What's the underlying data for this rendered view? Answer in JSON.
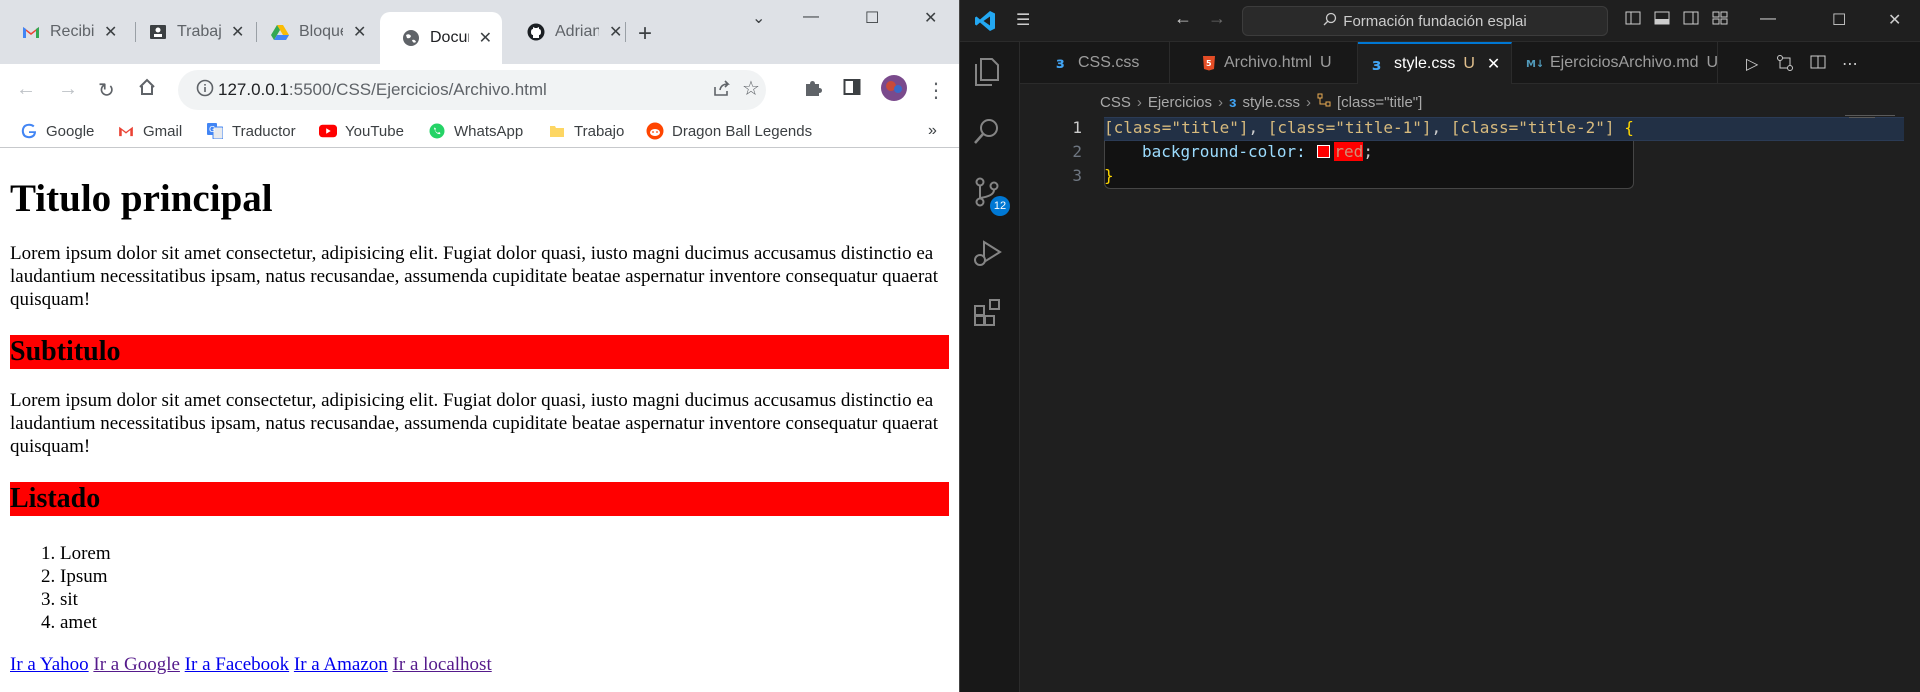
{
  "chrome": {
    "tabs": [
      {
        "title": "Recibi",
        "icon": "gmail-icon"
      },
      {
        "title": "Trabaj",
        "icon": "classroom-icon"
      },
      {
        "title": "Bloque",
        "icon": "drive-icon"
      },
      {
        "title": "Docum",
        "icon": "globe-icon",
        "active": true
      },
      {
        "title": "Adrian",
        "icon": "github-icon"
      }
    ],
    "new_tab": "+",
    "url_host": "127.0.0.1",
    "url_path": ":5500/CSS/Ejercicios/Archivo.html",
    "bookmarks": [
      "Google",
      "Gmail",
      "Traductor",
      "YouTube",
      "WhatsApp",
      "Trabajo",
      "Dragon Ball Legends"
    ],
    "bookmarks_more": "»"
  },
  "page": {
    "title": "Titulo principal",
    "paragraph1": "Lorem ipsum dolor sit amet consectetur, adipisicing elit. Fugiat dolor quasi, iusto magni ducimus accusamus distinctio ea laudantium necessitatibus ipsam, natus recusandae, assumenda cupiditate beatae aspernatur inventore consequatur quaerat quisquam!",
    "subtitle": "Subtitulo",
    "paragraph2": "Lorem ipsum dolor sit amet consectetur, adipisicing elit. Fugiat dolor quasi, iusto magni ducimus accusamus distinctio ea laudantium necessitatibus ipsam, natus recusandae, assumenda cupiditate beatae aspernatur inventore consequatur quaerat quisquam!",
    "list_heading": "Listado",
    "list": [
      "Lorem",
      "Ipsum",
      "sit",
      "amet"
    ],
    "links": [
      "Ir a Yahoo",
      "Ir a Google",
      "Ir a Facebook",
      "Ir a Amazon",
      "Ir a localhost"
    ]
  },
  "vscode": {
    "search": "Formación fundación esplai",
    "scm_badge": "12",
    "tabs": [
      {
        "title": "CSS.css",
        "modified": ""
      },
      {
        "title": "Archivo.html",
        "modified": "U"
      },
      {
        "title": "style.css",
        "modified": "U"
      },
      {
        "title": "EjerciciosArchivo.md",
        "modified": "U"
      }
    ],
    "breadcrumbs": [
      "CSS",
      "Ejercicios",
      "style.css",
      "[class=\"title\"]"
    ],
    "line_numbers": [
      "1",
      "2",
      "3"
    ],
    "code": {
      "sel1": "[class=\"title\"]",
      "sel2": "[class=\"title-1\"]",
      "sel3": "[class=\"title-2\"]",
      "open": "{",
      "prop": "background-color:",
      "val": "red",
      "semi": ";",
      "close": "}"
    }
  },
  "colors": {
    "heading_bg": "#ff0000",
    "vscode_accent": "#0078d4"
  }
}
